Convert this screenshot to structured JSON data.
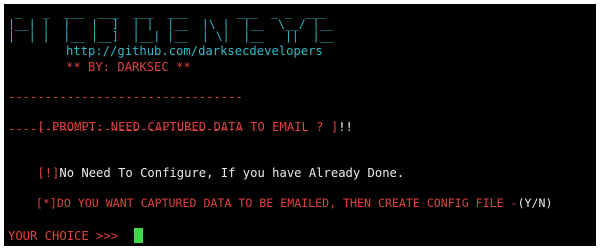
{
  "banner": {
    "art_lines": [
      " _   _  ___  ___  ___  ___       ___  _ _  ___",
      "|__| |  |   |  ]  | |  |__  |\\ |  |__  \\__/ |__",
      "|  | |  |__ |__]  |__| |__  | \\|  |__   ||  |__"
    ],
    "url": "http://github.com/darksecdevelopers",
    "credit": "** BY: DARKSEC **"
  },
  "prompt_block": {
    "rule_top": "--------------------------------",
    "prompt_open": "[ PROMPT: NEED CAPTURED DATA TO EMAIL ? ]",
    "prompt_exclaim": "!!",
    "rule_bottom": "--------------------------------"
  },
  "info_line": {
    "tag": "[!]",
    "text": "No Need To Configure, If you have Already Done."
  },
  "question_line": {
    "tag": "[*]",
    "text": "DO YOU WANT CAPTURED DATA TO BE EMAILED, THEN CREATE CONFIG FILE -",
    "options": "(Y/N)"
  },
  "input_line": {
    "label": "YOUR CHOICE >>> "
  },
  "colors": {
    "background": "#000000",
    "cyan": "#33b9c8",
    "red": "#e0403f",
    "white": "#eaeaea",
    "cursor": "#3fd84a"
  }
}
